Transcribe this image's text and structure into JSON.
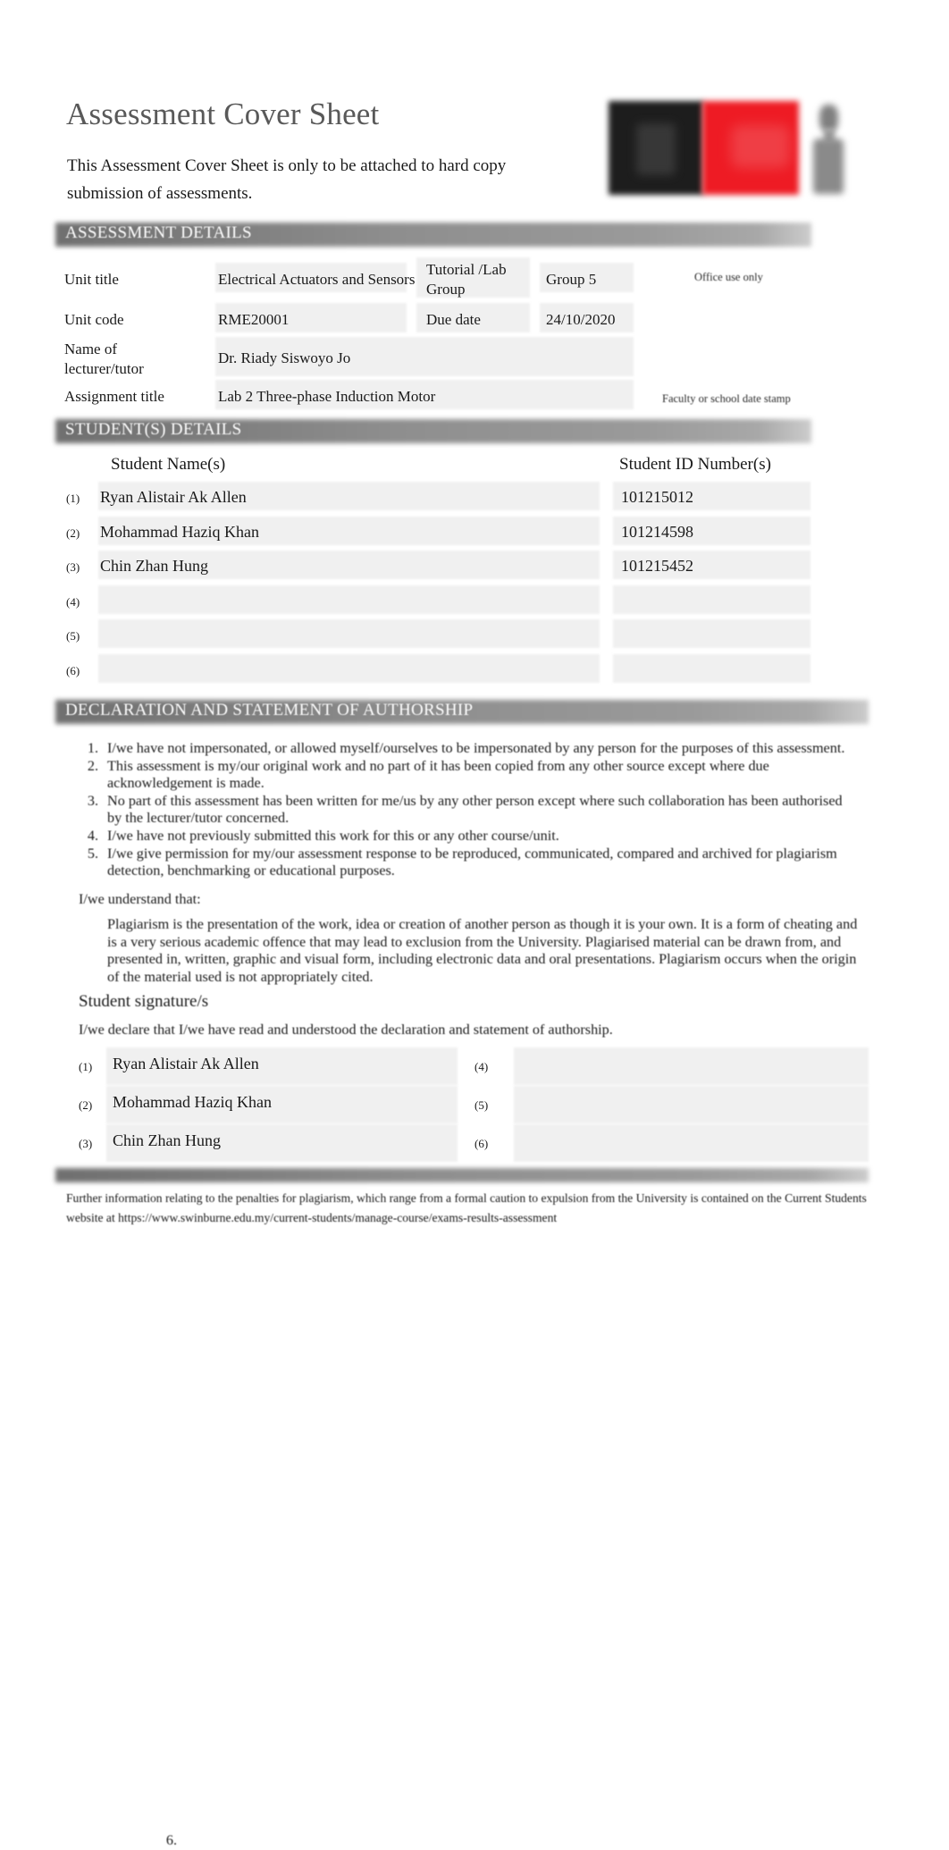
{
  "document": {
    "title": "Assessment Cover Sheet",
    "subtitle": "This Assessment Cover Sheet is only to be attached to hard copy submission of assessments."
  },
  "logo": {
    "black_block": "swinburne-logo-black-block",
    "red_block": "swinburne-logo-red-block",
    "figure": "sarawak-figure-mark"
  },
  "assessment_details": {
    "section_title": "ASSESSMENT DETAILS",
    "rows": {
      "unit_title_label": "Unit title",
      "unit_title_value": "Electrical Actuators and Sensors",
      "tutorial_group_label": "Tutorial /Lab Group",
      "tutorial_group_value": "Group 5",
      "unit_code_label": "Unit code",
      "unit_code_value": "RME20001",
      "due_date_label": "Due date",
      "due_date_value": "24/10/2020",
      "lecturer_label": "Name of lecturer/tutor",
      "lecturer_value": "Dr. Riady Siswoyo Jo",
      "assignment_title_label": "Assignment title",
      "assignment_title_value": "Lab 2 Three-phase Induction Motor"
    },
    "office_use_only": "Office use only",
    "date_stamp": "Faculty or school date stamp"
  },
  "student_details": {
    "section_title": "STUDENT(S) DETAILS",
    "col_name_header": "Student Name(s)",
    "col_id_header": "Student ID Number(s)",
    "rows": [
      {
        "index": "(1)",
        "name": "Ryan Alistair Ak Allen",
        "id": "101215012"
      },
      {
        "index": "(2)",
        "name": "Mohammad Haziq Khan",
        "id": "101214598"
      },
      {
        "index": "(3)",
        "name": "Chin Zhan Hung",
        "id": "101215452"
      },
      {
        "index": "(4)",
        "name": "",
        "id": ""
      },
      {
        "index": "(5)",
        "name": "",
        "id": ""
      },
      {
        "index": "(6)",
        "name": "",
        "id": ""
      }
    ]
  },
  "declaration": {
    "section_title": "DECLARATION AND STATEMENT OF AUTHORSHIP",
    "items": [
      {
        "num": "1.",
        "text": "I/we have not impersonated, or allowed myself/ourselves to be impersonated by any person for the purposes of this assessment."
      },
      {
        "num": "2.",
        "text": "This assessment is my/our original work and no part of it has been copied from any other source except where due acknowledgement is made."
      },
      {
        "num": "3.",
        "text": "No part of this assessment has been written for me/us by any other person except where such collaboration has been authorised by the lecturer/tutor concerned."
      },
      {
        "num": "4.",
        "text": "I/we have not previously submitted this work for this or any other course/unit."
      },
      {
        "num": "5.",
        "text": "I/we  give permission for my/our assessment response to be reproduced, communicated, compared and archived for plagiarism detection, benchmarking or educational purposes."
      }
    ],
    "understand_intro": "I/we understand that:",
    "item6_num": "6.",
    "item6_text": "Plagiarism is the presentation of the work, idea or creation of another person as though it is your own. It is a form of cheating and is a very serious academic offence that may lead to exclusion from the University. Plagiarised material can be drawn from, and presented in, written, graphic and visual form, including electronic data and oral presentations. Plagiarism occurs when the origin of the material used is not appropriately cited."
  },
  "signatures": {
    "heading": "Student signature/s",
    "subtext": "I/we declare that I/we have read and understood the declaration and statement of authorship.",
    "left_column": [
      {
        "index": "(1)",
        "value": "Ryan Alistair Ak Allen"
      },
      {
        "index": "(2)",
        "value": "Mohammad Haziq Khan"
      },
      {
        "index": "(3)",
        "value": "Chin Zhan Hung"
      }
    ],
    "right_column": [
      {
        "index": "(4)",
        "value": ""
      },
      {
        "index": "(5)",
        "value": ""
      },
      {
        "index": "(6)",
        "value": ""
      }
    ]
  },
  "footer": {
    "text": "Further information relating to the penalties for plagiarism, which range from a formal caution to expulsion from the University is contained on the Current Students website at  https://www.swinburne.edu.my/current-students/manage-course/exams-results-assessment"
  },
  "colors": {
    "title_grey": "#595959",
    "bar_grey": "#8e8e8e",
    "field_shade": "#f0f0f0",
    "logo_red": "#ee1b24",
    "logo_black": "#1d1d1d"
  }
}
